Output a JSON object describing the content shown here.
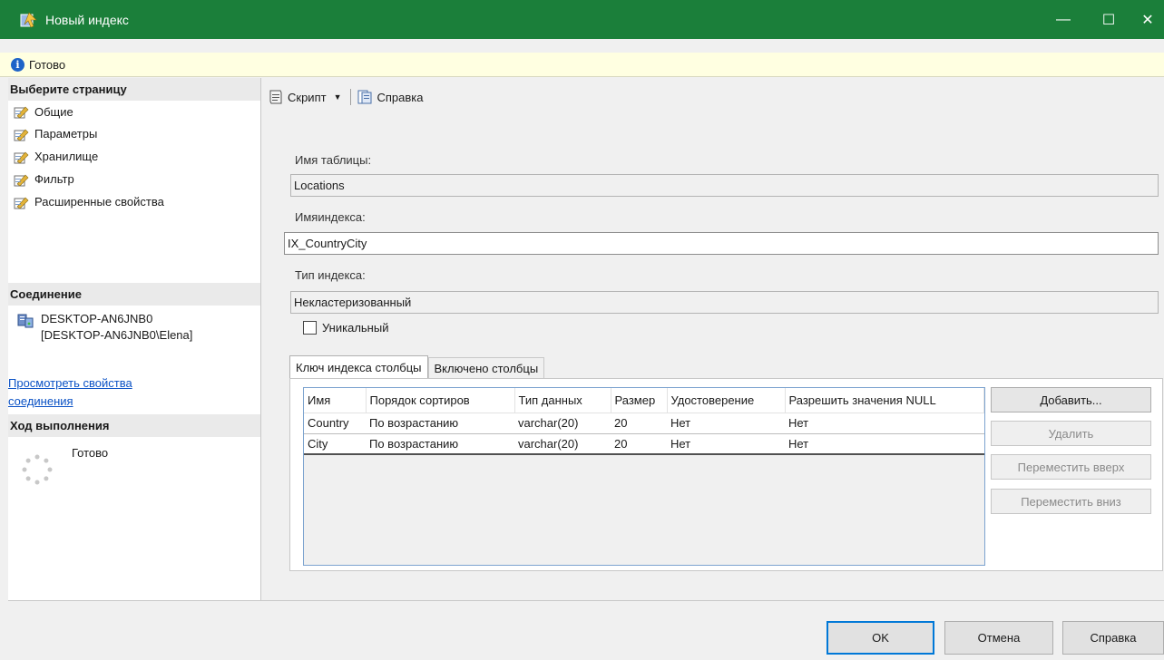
{
  "window": {
    "title": "Новый индекс",
    "controls": {
      "minimize": "—",
      "maximize": "☐",
      "close": "✕"
    }
  },
  "status": {
    "text": "Готово"
  },
  "left": {
    "select_page_header": "Выберите страницу",
    "pages": [
      {
        "label": "Общие"
      },
      {
        "label": "Параметры"
      },
      {
        "label": "Хранилище"
      },
      {
        "label": "Фильтр"
      },
      {
        "label": "Расширенные свойства"
      }
    ],
    "connection_header": "Соединение",
    "connection_server": "DESKTOP-AN6JNB0",
    "connection_user": "[DESKTOP-AN6JNB0\\Elena]",
    "view_props_link_line1": "Просмотреть свойства",
    "view_props_link_line2": "соединения",
    "progress_header": "Ход выполнения",
    "progress_text": "Готово"
  },
  "toolbar": {
    "script_label": "Скрипт",
    "help_label": "Справка"
  },
  "form": {
    "table_name_label": "Имя таблицы:",
    "table_name_value": "Locations",
    "index_name_label": "Имяиндекса:",
    "index_name_value": "IX_CountryCity",
    "index_type_label": "Тип индекса:",
    "index_type_value": "Некластеризованный",
    "unique_label": "Уникальный",
    "unique_checked": false
  },
  "tabs": [
    {
      "label": "Ключ индекса столбцы",
      "active": true
    },
    {
      "label": "Включено столбцы",
      "active": false
    }
  ],
  "grid": {
    "columns": [
      "Имя",
      "Порядок сортиров",
      "Тип данных",
      "Размер",
      "Удостоверение",
      "Разрешить значения NULL"
    ],
    "rows": [
      [
        "Country",
        "По возрастанию",
        "varchar(20)",
        "20",
        "Нет",
        "Нет"
      ],
      [
        "City",
        "По возрастанию",
        "varchar(20)",
        "20",
        "Нет",
        "Нет"
      ]
    ]
  },
  "side_buttons": {
    "add": "Добавить...",
    "remove": "Удалить",
    "move_up": "Переместить вверх",
    "move_down": "Переместить вниз"
  },
  "footer": {
    "ok": "OK",
    "cancel": "Отмена",
    "help": "Справка"
  },
  "colors": {
    "titlebar": "#1b7f3a",
    "status_bg": "#ffffe1",
    "link": "#0b52c5",
    "accent": "#0078d7"
  }
}
